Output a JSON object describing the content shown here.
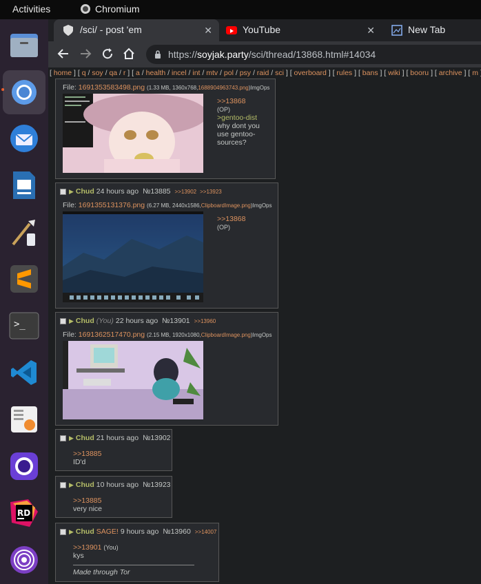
{
  "topbar": {
    "activities": "Activities",
    "app": "Chromium"
  },
  "tabs": [
    {
      "title": "/sci/ - post 'em"
    },
    {
      "title": "YouTube"
    },
    {
      "title": "New Tab"
    }
  ],
  "omnibox": {
    "prefix": "https://",
    "domain": "soyjak.party",
    "path": "/sci/thread/13868.html#14034"
  },
  "boardlist": [
    "home",
    "q",
    "soy",
    "qa",
    "r",
    "a",
    "health",
    "incel",
    "int",
    "mtv",
    "pol",
    "psy",
    "raid",
    "sci",
    "overboard",
    "rules",
    "bans",
    "wiki",
    "booru",
    "archive",
    "m"
  ],
  "posts": [
    {
      "file_label": "File:",
      "file_name": "1691353583498.png",
      "file_meta": "(1.33 MB, 1360x768,",
      "file_orig": "1688904963743.png",
      "file_suffix": ")ImgOps",
      "quote": ">>13868",
      "op_tag": "(OP)",
      "green": ">gentoo-dist",
      "text": "why dont you use gentoo-sources?"
    },
    {
      "name": "Chud",
      "time": "24 hours ago",
      "no": "№13885",
      "replies": [
        ">>13902",
        ">>13923"
      ],
      "file_label": "File:",
      "file_name": "1691355131376.png",
      "file_meta": "(6.27 MB, 2440x1586,",
      "file_orig": "ClipboardImage.png",
      "file_suffix": ")ImgOps",
      "quote": ">>13868",
      "op_tag": "(OP)"
    },
    {
      "name": "Chud",
      "you": "(You)",
      "time": "22 hours ago",
      "no": "№13901",
      "replies": [
        ">>13960"
      ],
      "file_label": "File:",
      "file_name": "1691362517470.png",
      "file_meta": "(2.15 MB, 1920x1080,",
      "file_orig": "ClipboardImage.png",
      "file_suffix": ")ImgOps"
    },
    {
      "name": "Chud",
      "time": "21 hours ago",
      "no": "№13902",
      "quote": ">>13885",
      "text": "ID'd"
    },
    {
      "name": "Chud",
      "time": "10 hours ago",
      "no": "№13923",
      "quote": ">>13885",
      "text": "very nice"
    },
    {
      "name": "Chud",
      "sage": "SAGE!",
      "time": "9 hours ago",
      "no": "№13960",
      "replies": [
        ">>14007"
      ],
      "quote": ">>13901",
      "quote_you": "(You)",
      "text": "kys",
      "signature": "Made through Tor"
    }
  ],
  "dock_icons": [
    "files-icon",
    "chromium-icon",
    "thunderbird-icon",
    "libreoffice-impress-icon",
    "paint-brush-icon",
    "sublime-text-icon",
    "terminal-icon",
    "vscode-icon",
    "rss-reader-icon",
    "tor-browser-launcher-icon",
    "rider-icon",
    "tor-icon"
  ]
}
